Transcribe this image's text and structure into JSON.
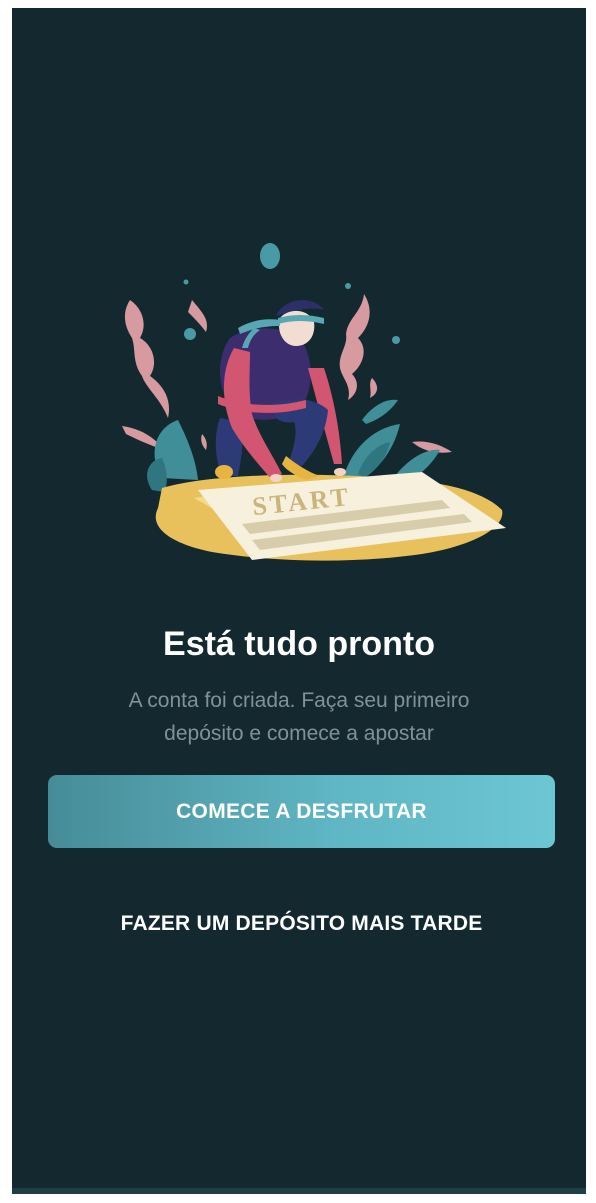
{
  "onboarding": {
    "illustration_icon": "runner-at-start-line-illustration",
    "illustration_text": "START",
    "title": "Está tudo pronto",
    "subtitle_line1": "A conta foi criada. Faça seu primeiro",
    "subtitle_line2": "depósito e comece a apostar",
    "primary_button_label": "COMECE A DESFRUTAR",
    "secondary_button_label": "FAZER UM DEPÓSITO MAIS TARDE"
  },
  "colors": {
    "background": "#13292f",
    "accent": "#5fb5c3",
    "subtitle": "#7f9297",
    "text": "#ffffff"
  }
}
